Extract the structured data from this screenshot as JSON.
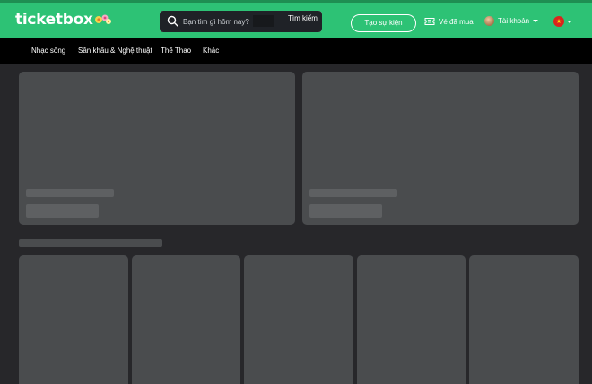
{
  "header": {
    "logo_text": "ticketbox",
    "search": {
      "placeholder": "Bạn tìm gì hôm nay?",
      "button_label": "Tìm kiếm"
    },
    "create_event_label": "Tạo sự kiện",
    "tickets_label": "Vé đã mua",
    "account_label": "Tài khoản"
  },
  "nav": {
    "items": [
      {
        "label": "Nhạc sống"
      },
      {
        "label": "Sân khấu & Nghệ thuật"
      },
      {
        "label": "Thể Thao"
      },
      {
        "label": "Khác"
      }
    ]
  },
  "colors": {
    "brand_green": "#2dc275",
    "skeleton": "#4a4c4e",
    "background": "#27272a"
  }
}
